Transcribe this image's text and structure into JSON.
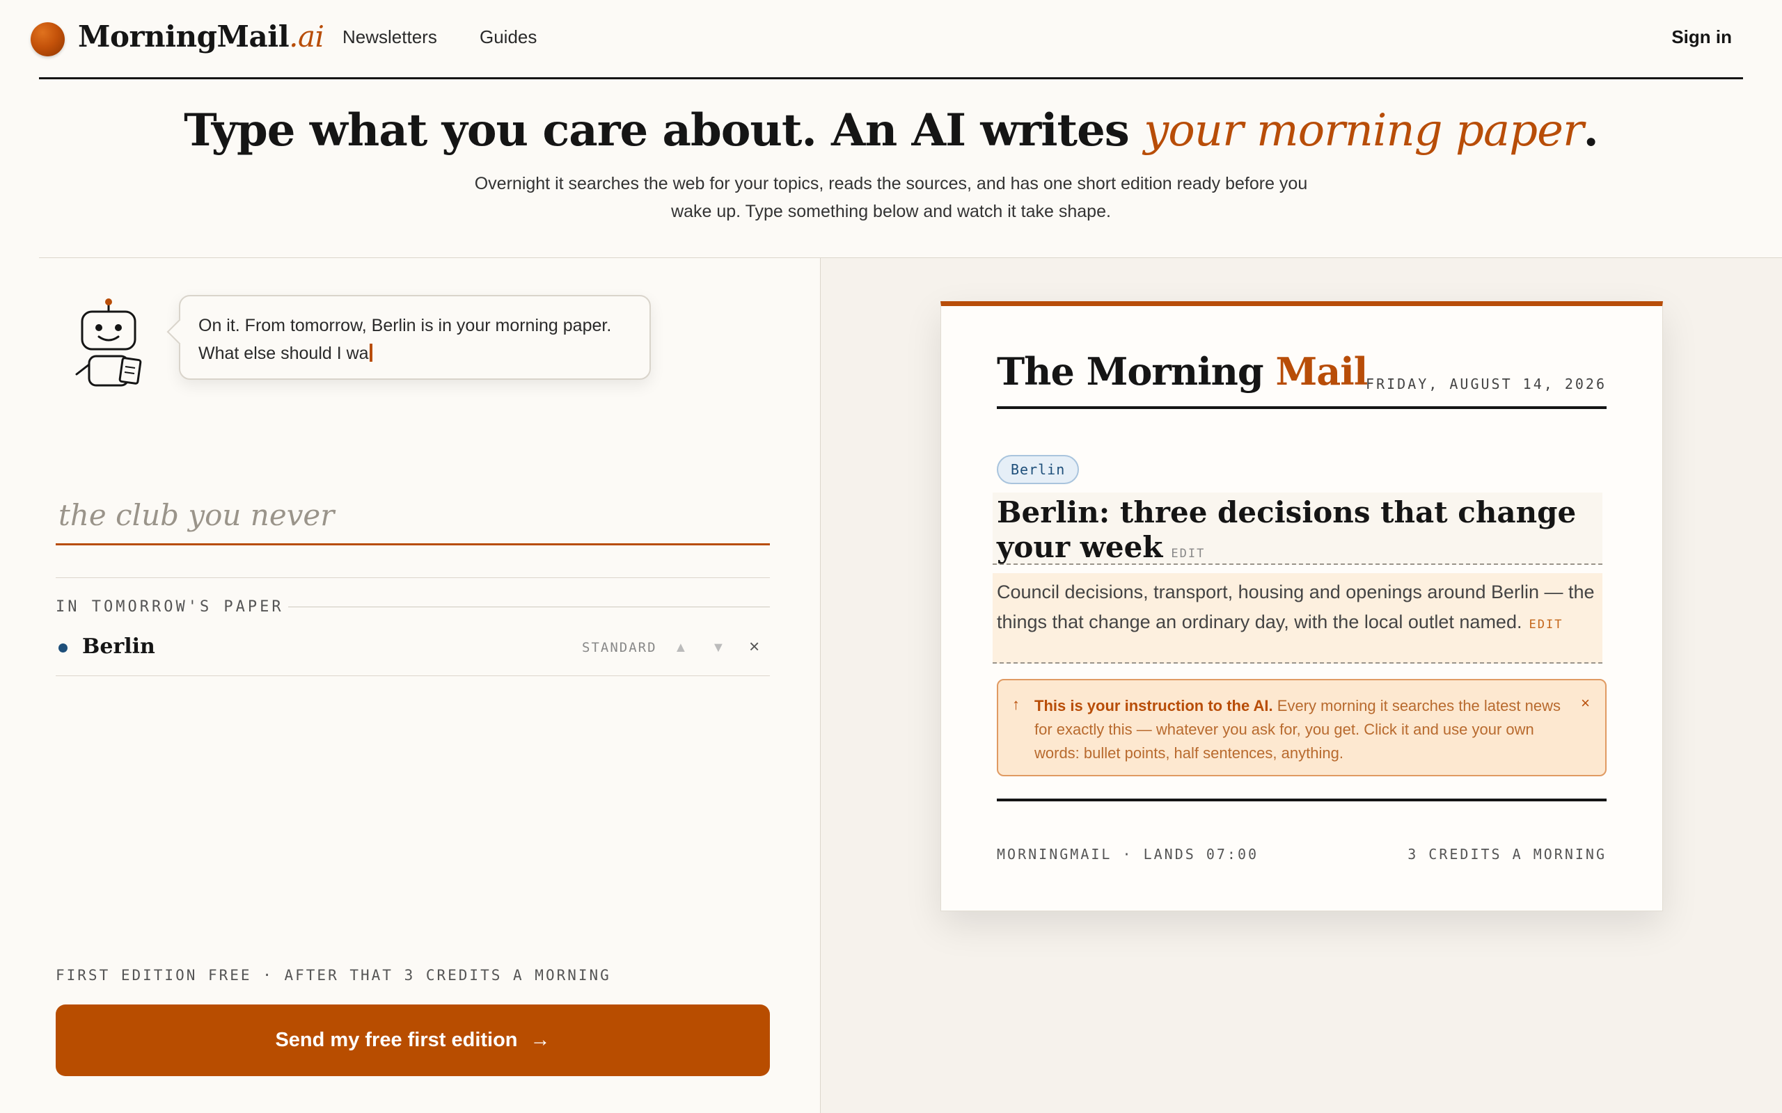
{
  "nav": {
    "brand_main": "MorningMail",
    "brand_suffix": ".ai",
    "links": [
      "Newsletters",
      "Guides"
    ],
    "signin": "Sign in"
  },
  "hero": {
    "title_plain": "Type what you care about. An AI writes ",
    "title_accent": "your morning paper",
    "title_end": ".",
    "subtitle": "Overnight it searches the web for your topics, reads the sources, and has one short edition ready before you wake up. Type something below and watch it take shape."
  },
  "assistant": {
    "bubble_text": "On it. From tomorrow, Berlin is in your morning paper. What else should I wa"
  },
  "topic_input": {
    "placeholder": "the club you never",
    "value": ""
  },
  "paper_list": {
    "label": "IN TOMORROW'S PAPER",
    "items": [
      {
        "name": "Berlin",
        "depth": "STANDARD",
        "dot_color": "#1e4f7a"
      }
    ]
  },
  "footer_note": "FIRST EDITION FREE · AFTER THAT 3 CREDITS A MORNING",
  "cta": {
    "label": "Send my free first edition",
    "arrow": "→"
  },
  "preview": {
    "masthead_plain": "The Morning ",
    "masthead_accent": "Mail",
    "date": "FRIDAY, AUGUST 14, 2026",
    "tag": "Berlin",
    "headline": "Berlin: three decisions that change your week",
    "summary": "Council decisions, transport, housing and openings around Berlin — the things that change an ordinary day, with the local outlet named.",
    "edit_label": "EDIT",
    "hint_bold": "This is your instruction to the AI.",
    "hint_text": " Every morning it searches the latest news for exactly this — whatever you ask for, you get. Click it and use your own words: bullet points, half sentences, anything.",
    "footer_left": "MORNINGMAIL · LANDS 07:00",
    "footer_right": "3 CREDITS A MORNING"
  },
  "colors": {
    "accent": "#b84d08",
    "topic_blue": "#1e4f7a",
    "background": "#fcfaf6"
  }
}
